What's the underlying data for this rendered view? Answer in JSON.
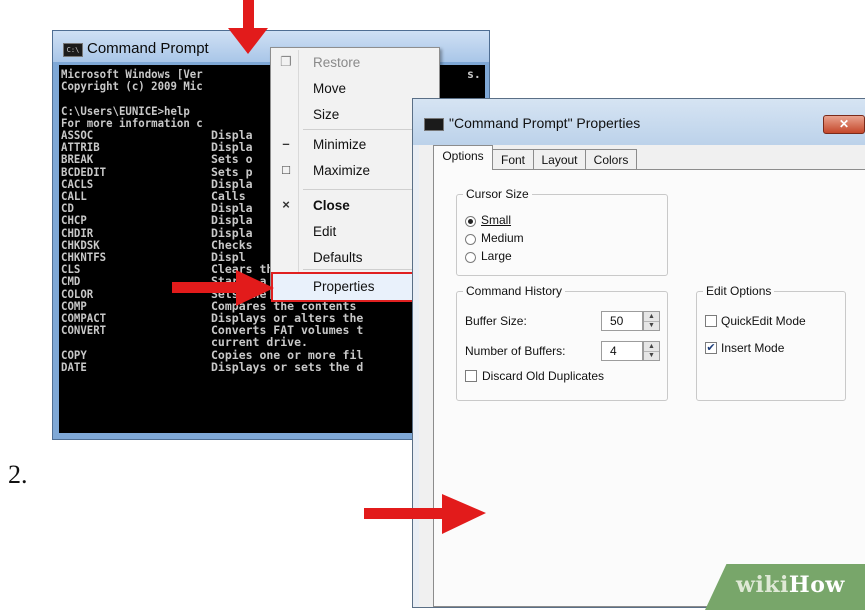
{
  "step_number": "2.",
  "cmd_window": {
    "title": "Command Prompt",
    "console_lines": [
      "Microsoft Windows [Ver",
      "Copyright (c) 2009 Mic",
      "",
      "C:\\Users\\EUNICE>help",
      "For more information c"
    ],
    "console_right_fragments": [
      "s.  A",
      ""
    ],
    "commands": [
      {
        "name": "ASSOC",
        "desc": "Displa"
      },
      {
        "name": "ATTRIB",
        "desc": "Displa"
      },
      {
        "name": "BREAK",
        "desc": "Sets o"
      },
      {
        "name": "BCDEDIT",
        "desc": "Sets p"
      },
      {
        "name": "CACLS",
        "desc": "Displa"
      },
      {
        "name": "CALL",
        "desc": "Calls "
      },
      {
        "name": "CD",
        "desc": "Displa"
      },
      {
        "name": "CHCP",
        "desc": "Displa"
      },
      {
        "name": "CHDIR",
        "desc": "Displa"
      },
      {
        "name": "CHKDSK",
        "desc": "Checks"
      },
      {
        "name": "CHKNTFS",
        "desc": "Displ"
      },
      {
        "name": "CLS",
        "desc": "Clears the screen."
      },
      {
        "name": "CMD",
        "desc": "Starts a new instance"
      },
      {
        "name": "COLOR",
        "desc": "Sets the default conso"
      },
      {
        "name": "COMP",
        "desc": "Compares the contents"
      },
      {
        "name": "COMPACT",
        "desc": "Displays or alters the"
      },
      {
        "name": "CONVERT",
        "desc": "Converts FAT volumes t"
      },
      {
        "name": "",
        "desc": "current drive."
      },
      {
        "name": "COPY",
        "desc": "Copies one or more fil"
      },
      {
        "name": "DATE",
        "desc": "Displays or sets the d"
      }
    ]
  },
  "context_menu": {
    "items": [
      {
        "label": "Restore",
        "glyph": "❐",
        "disabled": true,
        "bold": false
      },
      {
        "label": "Move",
        "glyph": "",
        "disabled": false,
        "bold": false
      },
      {
        "label": "Size",
        "glyph": "",
        "disabled": false,
        "bold": false
      },
      {
        "label": "Minimize",
        "glyph": "–",
        "disabled": false,
        "bold": false
      },
      {
        "label": "Maximize",
        "glyph": "□",
        "disabled": false,
        "bold": false
      },
      {
        "label": "Close",
        "glyph": "×",
        "disabled": false,
        "bold": true
      },
      {
        "label": "Edit",
        "glyph": "",
        "disabled": false,
        "bold": false
      },
      {
        "label": "Defaults",
        "glyph": "",
        "disabled": false,
        "bold": false
      },
      {
        "label": "Properties",
        "glyph": "",
        "disabled": false,
        "bold": false,
        "highlighted": true
      }
    ]
  },
  "properties_dialog": {
    "title": "\"Command Prompt\" Properties",
    "close_glyph": "✕",
    "tabs": [
      "Options",
      "Font",
      "Layout",
      "Colors"
    ],
    "active_tab": "Options",
    "cursor_size": {
      "group_title": "Cursor Size",
      "options": [
        {
          "label": "Small",
          "selected": true
        },
        {
          "label": "Medium",
          "selected": false
        },
        {
          "label": "Large",
          "selected": false
        }
      ]
    },
    "command_history": {
      "group_title": "Command History",
      "buffer_size_label": "Buffer Size:",
      "buffer_size_value": "50",
      "num_buffers_label": "Number of Buffers:",
      "num_buffers_value": "4",
      "discard_label": "Discard Old Duplicates",
      "discard_checked": false
    },
    "edit_options": {
      "group_title": "Edit Options",
      "quickedit_label": "QuickEdit Mode",
      "quickedit_checked": false,
      "insert_label": "Insert Mode",
      "insert_checked": true
    }
  },
  "watermark": {
    "part1": "wiki",
    "part2": "How"
  },
  "colors": {
    "arrow": "#e21b1b",
    "console_bg": "#000000",
    "console_text": "#c8c8c8",
    "highlight_border": "#e02020"
  }
}
